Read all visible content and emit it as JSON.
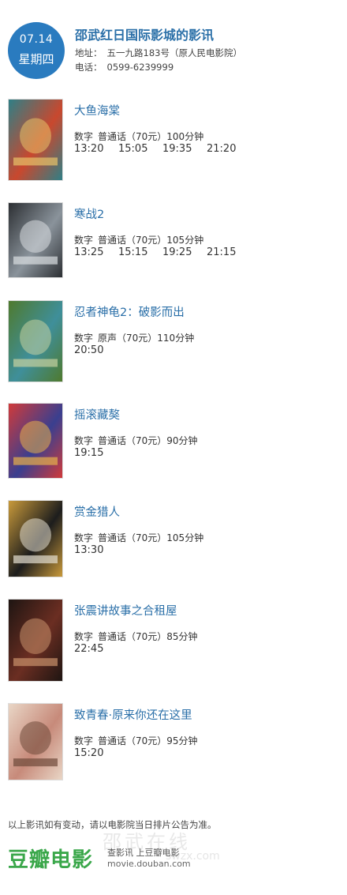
{
  "header": {
    "date": "07.14",
    "weekday": "星期四",
    "cinema_name": "邵武红日国际影城的影讯",
    "address_label": "地址：",
    "address": "五一九路183号（原人民电影院）",
    "phone_label": "电话：",
    "phone": "0599-6239999"
  },
  "movies": [
    {
      "title": "大鱼海棠",
      "format": "数字",
      "language": "普通话",
      "price": "（70元）",
      "duration": "100分钟",
      "times": [
        "13:20",
        "15:05",
        "19:35",
        "21:20"
      ],
      "poster_colors": [
        "#c9482e",
        "#2f7f86",
        "#e7c36a"
      ]
    },
    {
      "title": "寒战2",
      "format": "数字",
      "language": "普通话",
      "price": "（70元）",
      "duration": "105分钟",
      "times": [
        "13:25",
        "15:15",
        "19:25",
        "21:15"
      ],
      "poster_colors": [
        "#8a939b",
        "#2c2f33",
        "#d9dde0"
      ]
    },
    {
      "title": "忍者神龟2：破影而出",
      "format": "数字",
      "language": "原声",
      "price": "（70元）",
      "duration": "110分钟",
      "times": [
        "20:50"
      ],
      "poster_colors": [
        "#3f8f9a",
        "#4f7a2e",
        "#c7d1a0"
      ]
    },
    {
      "title": "摇滚藏獒",
      "format": "数字",
      "language": "普通话",
      "price": "（70元）",
      "duration": "90分钟",
      "times": [
        "19:15"
      ],
      "poster_colors": [
        "#3a3f8f",
        "#d03a3a",
        "#e8b04a"
      ]
    },
    {
      "title": "赏金猎人",
      "format": "数字",
      "language": "普通话",
      "price": "（70元）",
      "duration": "105分钟",
      "times": [
        "13:30"
      ],
      "poster_colors": [
        "#1d1d1d",
        "#c99a3b",
        "#e6e0d2"
      ]
    },
    {
      "title": "张震讲故事之合租屋",
      "format": "数字",
      "language": "普通话",
      "price": "（70元）",
      "duration": "85分钟",
      "times": [
        "22:45"
      ],
      "poster_colors": [
        "#6b2e22",
        "#1e1512",
        "#c9916b"
      ]
    },
    {
      "title": "致青春·原来你还在这里",
      "format": "数字",
      "language": "普通话",
      "price": "（70元）",
      "duration": "95分钟",
      "times": [
        "15:20"
      ],
      "poster_colors": [
        "#c78a7a",
        "#e9d6c6",
        "#6f4a3a"
      ]
    }
  ],
  "footer": {
    "notice": "以上影讯如有变动，请以电影院当日排片公告为准。",
    "brand": "豆瓣电影",
    "brand_tagline": "查影讯 上豆瓣电影",
    "brand_url": "movie.douban.com",
    "watermark": "邵武在线",
    "watermark_url": "swzx.com"
  },
  "colors": {
    "accent": "#2a7bbf",
    "title": "#2a6fa8",
    "brand": "#3aa74a"
  }
}
